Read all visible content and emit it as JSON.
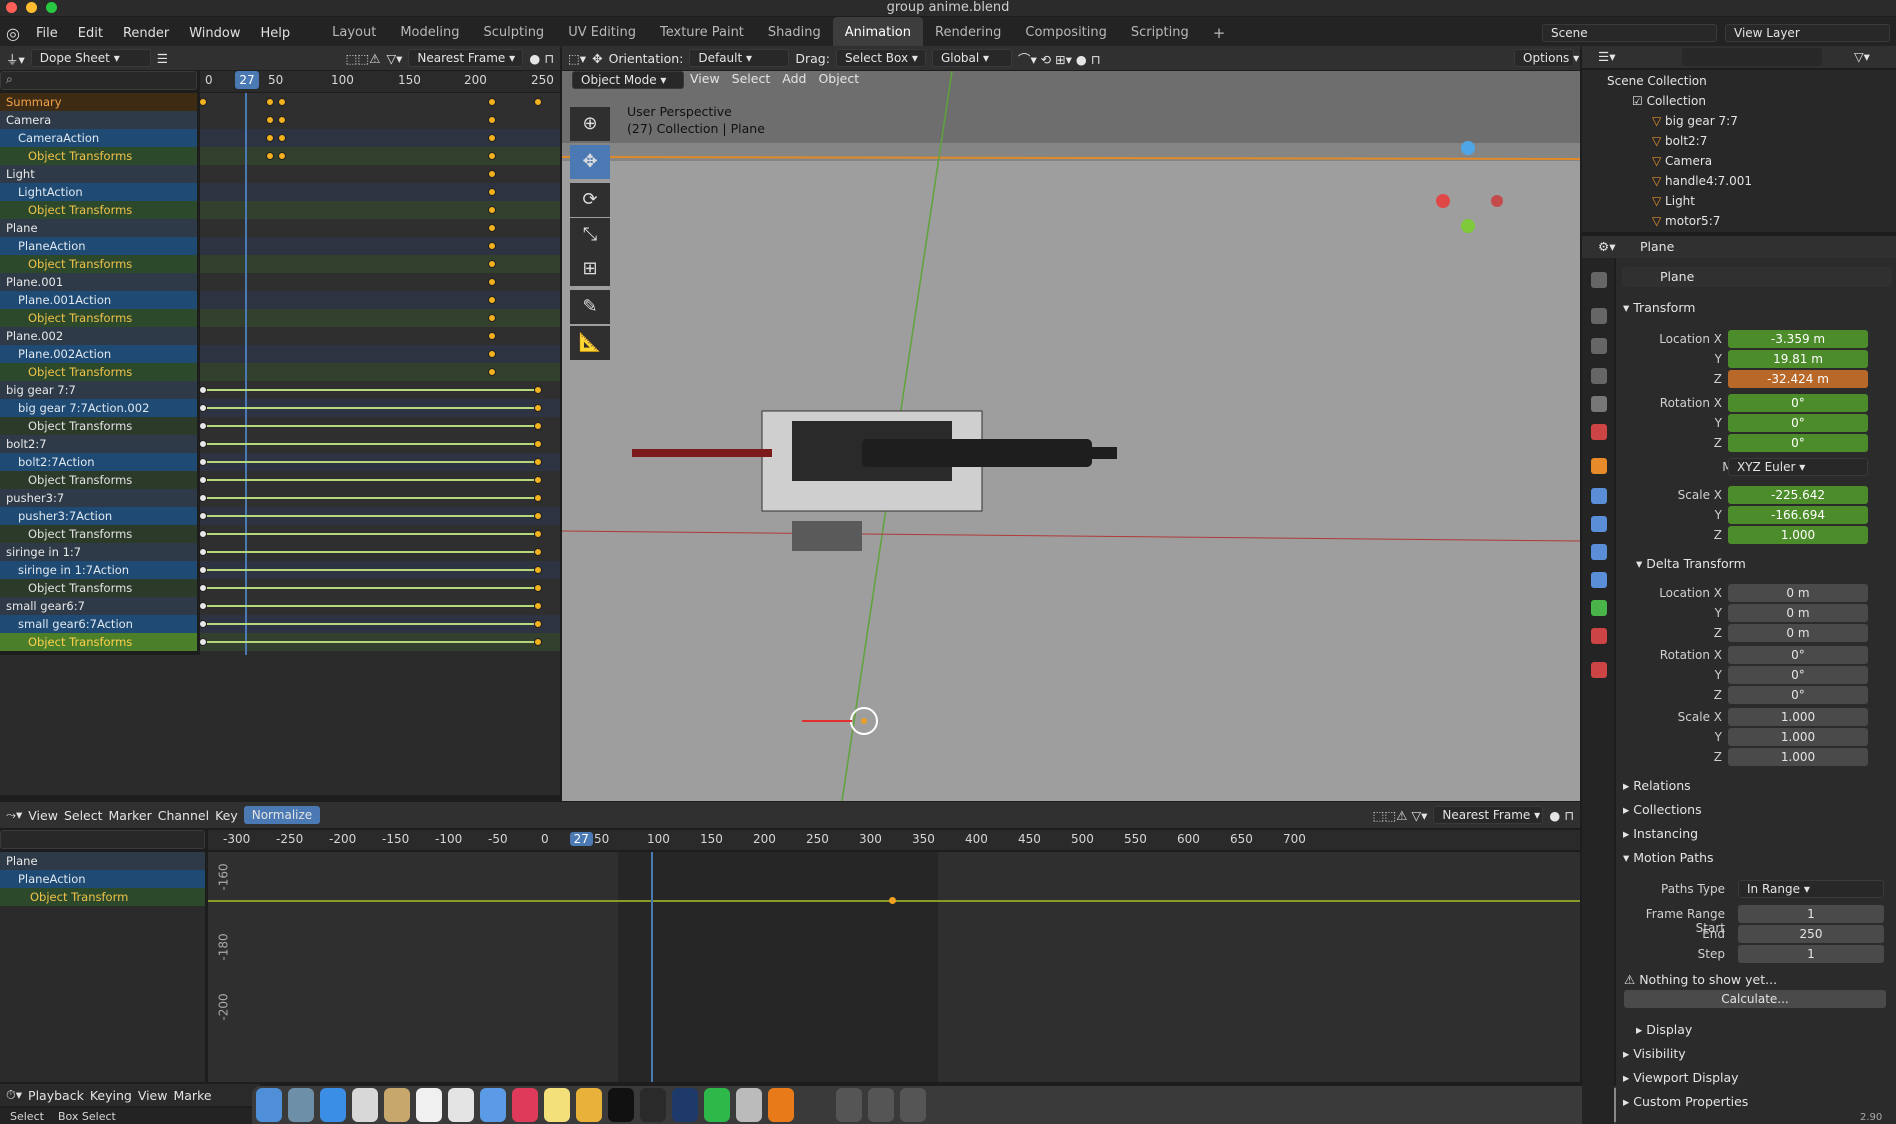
{
  "window": {
    "title": "group anime.blend"
  },
  "menu": [
    "File",
    "Edit",
    "Render",
    "Window",
    "Help"
  ],
  "workspaces": [
    "Layout",
    "Modeling",
    "Sculpting",
    "UV Editing",
    "Texture Paint",
    "Shading",
    "Animation",
    "Rendering",
    "Compositing",
    "Scripting"
  ],
  "active_workspace": "Animation",
  "scene": {
    "name": "Scene",
    "view_layer": "View Layer"
  },
  "dopesheet": {
    "mode": "Dope Sheet",
    "snap": "Nearest Frame",
    "current_frame": "27",
    "ruler": [
      "0",
      "50",
      "100",
      "150",
      "200",
      "250"
    ],
    "channels": [
      {
        "label": "Summary",
        "kind": "sum"
      },
      {
        "label": "Camera",
        "kind": "obj"
      },
      {
        "label": "CameraAction",
        "kind": "act"
      },
      {
        "label": "Object Transforms",
        "kind": "tr"
      },
      {
        "label": "Light",
        "kind": "obj"
      },
      {
        "label": "LightAction",
        "kind": "act"
      },
      {
        "label": "Object Transforms",
        "kind": "tr"
      },
      {
        "label": "Plane",
        "kind": "obj"
      },
      {
        "label": "PlaneAction",
        "kind": "act"
      },
      {
        "label": "Object Transforms",
        "kind": "tr"
      },
      {
        "label": "Plane.001",
        "kind": "obj"
      },
      {
        "label": "Plane.001Action",
        "kind": "act"
      },
      {
        "label": "Object Transforms",
        "kind": "tr"
      },
      {
        "label": "Plane.002",
        "kind": "obj"
      },
      {
        "label": "Plane.002Action",
        "kind": "act"
      },
      {
        "label": "Object Transforms",
        "kind": "tr"
      },
      {
        "label": "big gear 7:7",
        "kind": "obj"
      },
      {
        "label": "big gear 7:7Action.002",
        "kind": "act"
      },
      {
        "label": "Object Transforms",
        "kind": "trw"
      },
      {
        "label": "bolt2:7",
        "kind": "obj"
      },
      {
        "label": "bolt2:7Action",
        "kind": "act"
      },
      {
        "label": "Object Transforms",
        "kind": "trw"
      },
      {
        "label": "pusher3:7",
        "kind": "obj"
      },
      {
        "label": "pusher3:7Action",
        "kind": "act"
      },
      {
        "label": "Object Transforms",
        "kind": "trw"
      },
      {
        "label": "siringe in 1:7",
        "kind": "obj"
      },
      {
        "label": "siringe in 1:7Action",
        "kind": "act"
      },
      {
        "label": "Object Transforms",
        "kind": "trw"
      },
      {
        "label": "small gear6:7",
        "kind": "obj"
      },
      {
        "label": "small gear6:7Action",
        "kind": "act"
      },
      {
        "label": "Object Transforms",
        "kind": "sel"
      }
    ]
  },
  "viewport": {
    "header": {
      "orientation_label": "Orientation:",
      "orientation": "Default",
      "drag_label": "Drag:",
      "drag": "Select Box",
      "transform": "Global",
      "options": "Options"
    },
    "mode": "Object Mode",
    "menus": [
      "View",
      "Select",
      "Add",
      "Object"
    ],
    "overlay_title": "User Perspective",
    "overlay_sub": "(27) Collection | Plane"
  },
  "graph": {
    "menus": [
      "View",
      "Select",
      "Marker",
      "Channel",
      "Key"
    ],
    "normalize": "Normalize",
    "snap": "Nearest Frame",
    "ruler": [
      "-300",
      "-250",
      "-200",
      "-150",
      "-100",
      "-50",
      "0",
      "27",
      "50",
      "100",
      "150",
      "200",
      "250",
      "300",
      "350",
      "400",
      "450",
      "500",
      "550",
      "600",
      "650",
      "700"
    ],
    "y_labels": [
      "-160",
      "-180",
      "-200"
    ],
    "channels": [
      {
        "label": "Plane",
        "kind": "obj"
      },
      {
        "label": "PlaneAction",
        "kind": "act"
      },
      {
        "label": "Object Transform",
        "kind": "tr"
      }
    ]
  },
  "timeline": {
    "menus": [
      "Playback",
      "Keying",
      "View",
      "Marke"
    ]
  },
  "statusbar": {
    "select": "Select",
    "box": "Box Select"
  },
  "outliner": {
    "root": "Scene Collection",
    "collection": "Collection",
    "items": [
      "big gear 7:7",
      "bolt2:7",
      "Camera",
      "handle4:7.001",
      "Light",
      "motor5:7"
    ]
  },
  "properties": {
    "object_name": "Plane",
    "datablock": "Plane",
    "transform": {
      "title": "Transform",
      "location_label": "Location X",
      "location": [
        "-3.359 m",
        "19.81 m",
        "-32.424 m"
      ],
      "rotation_label": "Rotation X",
      "rotation": [
        "0°",
        "0°",
        "0°"
      ],
      "mode_label": "Mode",
      "mode": "XYZ Euler",
      "scale_label": "Scale X",
      "scale": [
        "-225.642",
        "-166.694",
        "1.000"
      ]
    },
    "delta": {
      "title": "Delta Transform",
      "location_label": "Location X",
      "location": [
        "0 m",
        "0 m",
        "0 m"
      ],
      "rotation_label": "Rotation X",
      "rotation": [
        "0°",
        "0°",
        "0°"
      ],
      "scale_label": "Scale X",
      "scale": [
        "1.000",
        "1.000",
        "1.000"
      ]
    },
    "axis_labels": [
      "Y",
      "Z"
    ],
    "sections": [
      "Relations",
      "Collections",
      "Instancing",
      "Motion Paths"
    ],
    "motion_paths": {
      "paths_type_label": "Paths Type",
      "paths_type": "In Range",
      "start_label": "Frame Range Start",
      "start": "1",
      "end_label": "End",
      "end": "250",
      "step_label": "Step",
      "step": "1",
      "warning": "Nothing to show yet...",
      "calculate": "Calculate...",
      "display": "Display"
    },
    "bottom_sections": [
      "Visibility",
      "Viewport Display",
      "Custom Properties"
    ],
    "version": "2.90"
  },
  "colors": {
    "accent": "#4a79b4",
    "keyframe": "#f2b21f",
    "location_field": "#4d8c2a",
    "z_field": "#b8692a"
  }
}
